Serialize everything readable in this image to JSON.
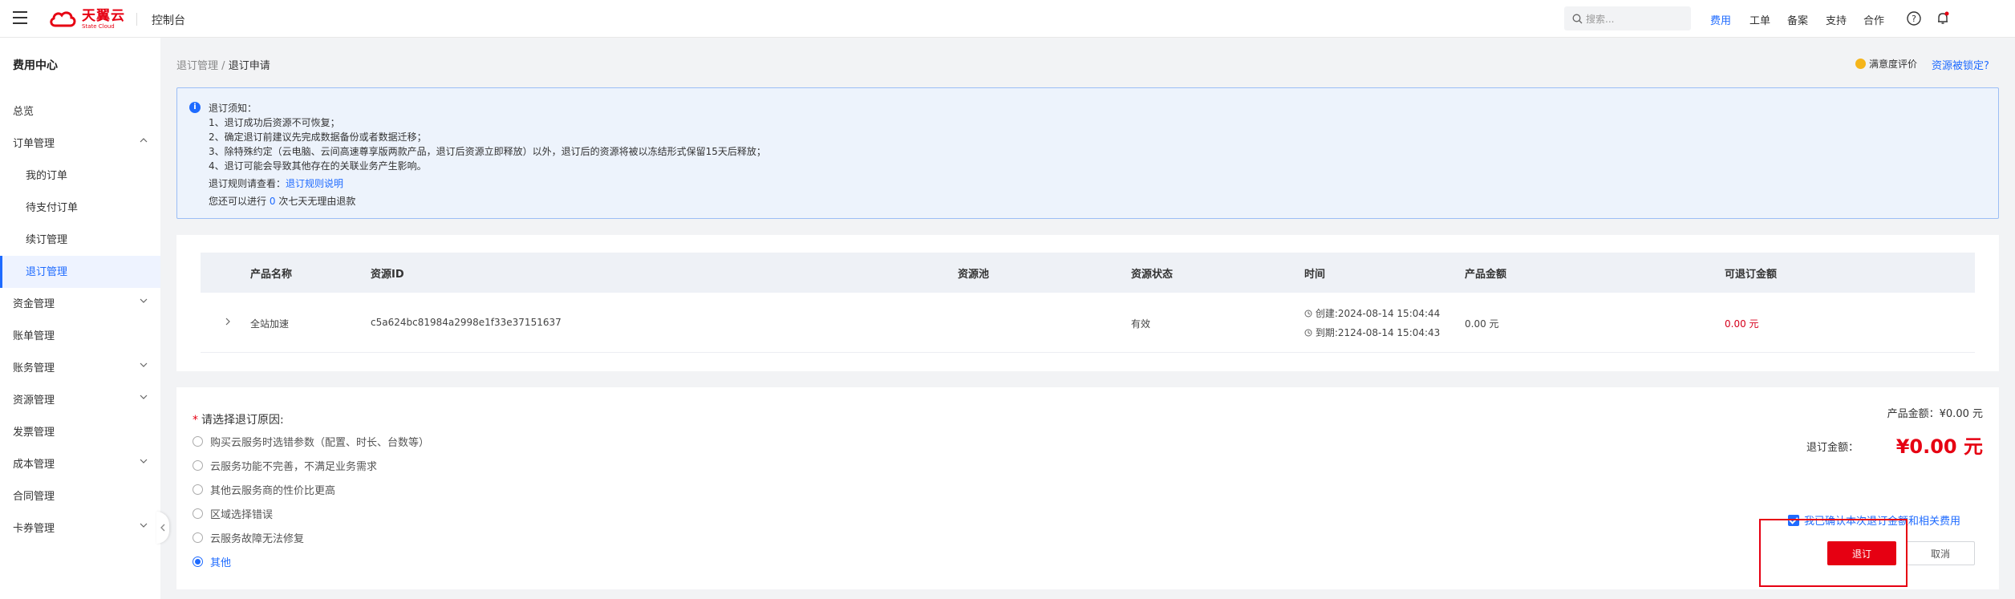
{
  "header": {
    "logo_cn": "天翼云",
    "logo_en": "State Cloud",
    "console": "控制台",
    "search_placeholder": "搜索...",
    "nav": [
      "费用",
      "工单",
      "备案",
      "支持",
      "合作"
    ]
  },
  "sidebar": {
    "title": "费用中心",
    "items": [
      {
        "label": "总览"
      },
      {
        "label": "订单管理"
      },
      {
        "label": "我的订单"
      },
      {
        "label": "待支付订单"
      },
      {
        "label": "续订管理"
      },
      {
        "label": "退订管理"
      },
      {
        "label": "资金管理"
      },
      {
        "label": "账单管理"
      },
      {
        "label": "账务管理"
      },
      {
        "label": "资源管理"
      },
      {
        "label": "发票管理"
      },
      {
        "label": "成本管理"
      },
      {
        "label": "合同管理"
      },
      {
        "label": "卡券管理"
      }
    ]
  },
  "breadcrumb": {
    "parent": "退订管理",
    "sep": "/",
    "current": "退订申请"
  },
  "toolbar": {
    "satisfaction": "满意度评价",
    "locked": "资源被锁定?"
  },
  "notice": {
    "title": "退订须知：",
    "lines": [
      "1、退订成功后资源不可恢复；",
      "2、确定退订前建议先完成数据备份或者数据迁移；",
      "3、除特殊约定（云电脑、云间高速尊享版两款产品，退订后资源立即释放）以外，退订后的资源将被以冻结形式保留15天后释放；",
      "4、退订可能会导致其他存在的关联业务产生影响。"
    ],
    "rule_prefix": "退订规则请查看：",
    "rule_link": "退订规则说明",
    "refund_prefix": "您还可以进行",
    "refund_count": "0",
    "refund_suffix": "次七天无理由退款"
  },
  "table": {
    "headers": [
      "产品名称",
      "资源ID",
      "资源池",
      "资源状态",
      "时间",
      "产品金额",
      "可退订金额"
    ],
    "rows": [
      {
        "product": "全站加速",
        "resource_id": "c5a624bc81984a2998e1f33e37151637",
        "pool": "",
        "status": "有效",
        "created": "创建:2024-08-14 15:04:44",
        "expires": "到期:2124-08-14 15:04:43",
        "amount": "0.00 元",
        "refundable": "0.00 元"
      }
    ]
  },
  "reason": {
    "title": "请选择退订原因:",
    "options": [
      "购买云服务时选错参数（配置、时长、台数等）",
      "云服务功能不完善，不满足业务需求",
      "其他云服务商的性价比更高",
      "区域选择错误",
      "云服务故障无法修复",
      "其他"
    ],
    "selected_index": 5
  },
  "summary": {
    "product_amount_label": "产品金额：",
    "product_amount": "¥0.00 元",
    "refund_amount_label": "退订金额：",
    "refund_amount": "¥0.00 元",
    "confirm_text": "我已确认本次退订金额和相关费用",
    "submit": "退订",
    "cancel": "取消"
  },
  "colors": {
    "brand_red": "#e60012",
    "link_blue": "#1f6bff"
  }
}
